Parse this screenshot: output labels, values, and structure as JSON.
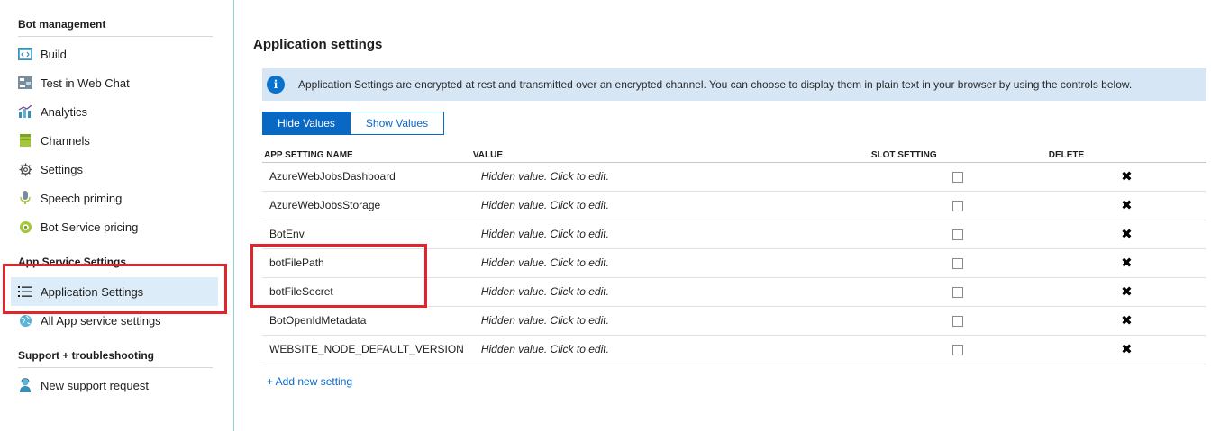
{
  "sidebar": {
    "sections": [
      {
        "title": "Bot management"
      },
      {
        "title": "App Service Settings"
      },
      {
        "title": "Support + troubleshooting"
      }
    ],
    "items": [
      {
        "label": "Build",
        "icon": "code-icon"
      },
      {
        "label": "Test in Web Chat",
        "icon": "chat-icon"
      },
      {
        "label": "Analytics",
        "icon": "analytics-icon"
      },
      {
        "label": "Channels",
        "icon": "channels-icon"
      },
      {
        "label": "Settings",
        "icon": "gear-icon"
      },
      {
        "label": "Speech priming",
        "icon": "microphone-icon"
      },
      {
        "label": "Bot Service pricing",
        "icon": "pricing-icon"
      },
      {
        "label": "Application Settings",
        "icon": "list-icon"
      },
      {
        "label": "All App service settings",
        "icon": "globe-icon"
      },
      {
        "label": "New support request",
        "icon": "support-person-icon"
      }
    ]
  },
  "main": {
    "title": "Application settings",
    "info_text": "Application Settings are encrypted at rest and transmitted over an encrypted channel. You can choose to display them in plain text in your browser by using the controls below.",
    "info_icon_glyph": "i",
    "hide_values_label": "Hide Values",
    "show_values_label": "Show Values",
    "columns": [
      "APP SETTING NAME",
      "VALUE",
      "SLOT SETTING",
      "DELETE"
    ],
    "rows": [
      {
        "name": "AzureWebJobsDashboard",
        "value": "Hidden value. Click to edit."
      },
      {
        "name": "AzureWebJobsStorage",
        "value": "Hidden value. Click to edit."
      },
      {
        "name": "BotEnv",
        "value": "Hidden value. Click to edit."
      },
      {
        "name": "botFilePath",
        "value": "Hidden value. Click to edit."
      },
      {
        "name": "botFileSecret",
        "value": "Hidden value. Click to edit."
      },
      {
        "name": "BotOpenIdMetadata",
        "value": "Hidden value. Click to edit."
      },
      {
        "name": "WEBSITE_NODE_DEFAULT_VERSION",
        "value": "Hidden value. Click to edit."
      }
    ],
    "delete_glyph": "✖",
    "add_setting_label": "+ Add new setting"
  },
  "colors": {
    "accent": "#0a68c5",
    "highlight_box": "#e0252c",
    "active_item_bg": "#dcecf9",
    "info_bar_bg": "#d6e6f5"
  }
}
